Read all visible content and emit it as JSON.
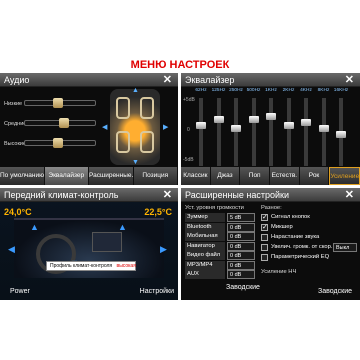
{
  "banner": "МЕНЮ НАСТРОЕК",
  "audio": {
    "title": "Аудио",
    "labels": [
      "Низкие",
      "Средние",
      "Высокие"
    ],
    "levels": [
      0.45,
      0.55,
      0.45
    ],
    "tabs": [
      "По умолчанию",
      "Эквалайзер",
      "Расширенные..",
      "Позиция"
    ],
    "active_tab": 1
  },
  "eq": {
    "title": "Эквалайзер",
    "freqs": [
      "62Hz",
      "125Hz",
      "250Hz",
      "500Hz",
      "1KHz",
      "2KHz",
      "4KHz",
      "8KHz",
      "16KHz"
    ],
    "levels": [
      0.4,
      0.3,
      0.45,
      0.3,
      0.25,
      0.4,
      0.35,
      0.45,
      0.55
    ],
    "scale_top": "+5dB",
    "scale_mid": "0",
    "scale_bot": "-5dB",
    "tabs": [
      "Классик",
      "Джаз",
      "Поп",
      "Естеств.",
      "Рок",
      "Усиление ..."
    ],
    "active_tab": 5
  },
  "climate": {
    "title": "Передний климат-контроль",
    "temp_left": "24,0°C",
    "temp_right": "22,5°C",
    "profile_label": "Профиль климат-контроля",
    "profile_value": "высокая",
    "power": "Power",
    "settings": "Настройки"
  },
  "advanced": {
    "title": "Расширенные настройки",
    "vol_header": "Уст. уровня громкости",
    "vol_rows": [
      {
        "label": "Зуммер",
        "value": "5 dB"
      },
      {
        "label": "Bluetooth",
        "value": "0 dB"
      },
      {
        "label": "Мобильная медиа",
        "value": "0 dB"
      },
      {
        "label": "Навигатор",
        "value": "0 dB"
      },
      {
        "label": "Видео файл",
        "value": "0 dB"
      },
      {
        "label": "MP3/MP4",
        "value": "0 dB"
      },
      {
        "label": "AUX",
        "value": "0 dB"
      }
    ],
    "misc_header": "Разное:",
    "misc_rows": [
      {
        "label": "Сигнал кнопок",
        "checked": true
      },
      {
        "label": "Микшер",
        "checked": true
      },
      {
        "label": "Нарастание звука",
        "checked": false
      },
      {
        "label": "Увелич. громк. от скор.",
        "checked": false,
        "value": "Выкл"
      },
      {
        "label": "Параметрический EQ",
        "checked": false
      }
    ],
    "subwoofer": "Усиление НЧ",
    "factory": "Заводские"
  },
  "factory_left": "Заводские"
}
